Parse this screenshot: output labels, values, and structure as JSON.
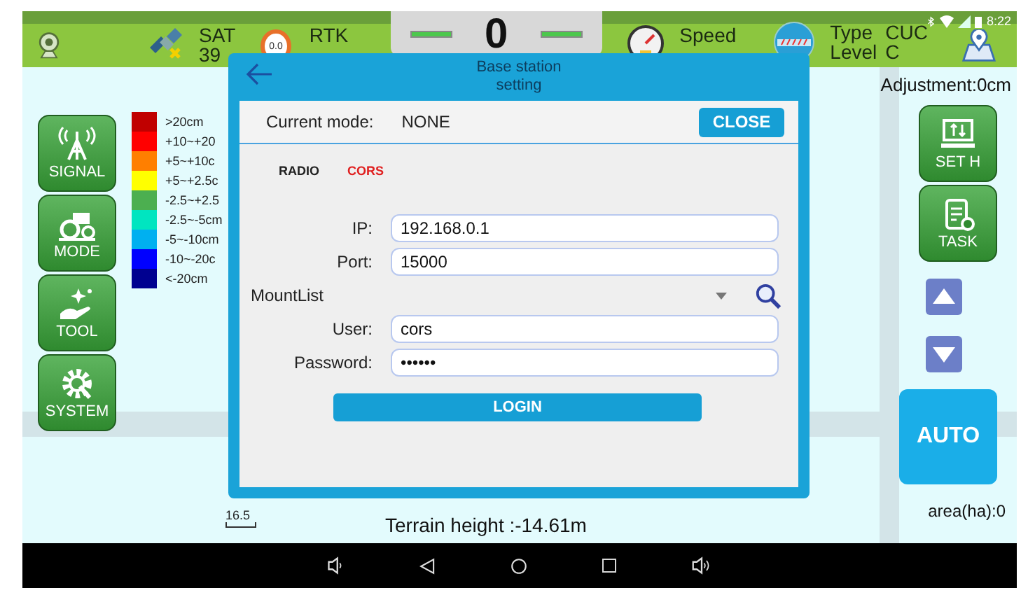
{
  "status_bar": {
    "sat_label": "SAT",
    "sat_count": "39",
    "gauge_reading": "0.0",
    "rtk_label": "RTK",
    "center_value": "0",
    "speed_label": "Speed",
    "type_label": "Type",
    "level_label": "Level",
    "type_value": "CUC",
    "level_value": "C",
    "time": "8:22"
  },
  "left_buttons": [
    {
      "label": "SIGNAL",
      "kind": "signal"
    },
    {
      "label": "MODE",
      "kind": "mode"
    },
    {
      "label": "TOOL",
      "kind": "tool"
    },
    {
      "label": "SYSTEM",
      "kind": "system"
    }
  ],
  "legend": [
    {
      "label": ">20cm",
      "color": "#c00000"
    },
    {
      "label": "+10~+20",
      "color": "#ff0000"
    },
    {
      "label": "+5~+10c",
      "color": "#ff7f00"
    },
    {
      "label": "+5~+2.5c",
      "color": "#ffff00"
    },
    {
      "label": "-2.5~+2.5",
      "color": "#4caf50"
    },
    {
      "label": "-2.5~-5cm",
      "color": "#00e5c0"
    },
    {
      "label": "-5~-10cm",
      "color": "#00b0f0"
    },
    {
      "label": "-10~-20c",
      "color": "#0000ff"
    },
    {
      "label": "<-20cm",
      "color": "#000090"
    }
  ],
  "adjustment": "Adjustment:0cm",
  "right_buttons": [
    {
      "label": "SET H",
      "kind": "seth"
    },
    {
      "label": "TASK",
      "kind": "task"
    }
  ],
  "auto_button": "AUTO",
  "area": "area(ha):0",
  "scale": "16.5",
  "terrain": "Terrain height :-14.61m",
  "dialog": {
    "title": "Base station setting",
    "current_mode_label": "Current mode:",
    "current_mode_value": "NONE",
    "close": "CLOSE",
    "tabs": [
      {
        "label": "RADIO",
        "selected": false
      },
      {
        "label": "CORS",
        "selected": true
      }
    ],
    "fields": [
      {
        "kind": "text",
        "label": "IP:",
        "value": "192.168.0.1"
      },
      {
        "kind": "text",
        "label": "Port:",
        "value": "15000"
      },
      {
        "kind": "dropdown",
        "label": "MountList"
      },
      {
        "kind": "text",
        "label": "User:",
        "value": "cors"
      },
      {
        "kind": "password",
        "label": "Password:",
        "value": "••••••"
      }
    ],
    "login": "LOGIN"
  }
}
